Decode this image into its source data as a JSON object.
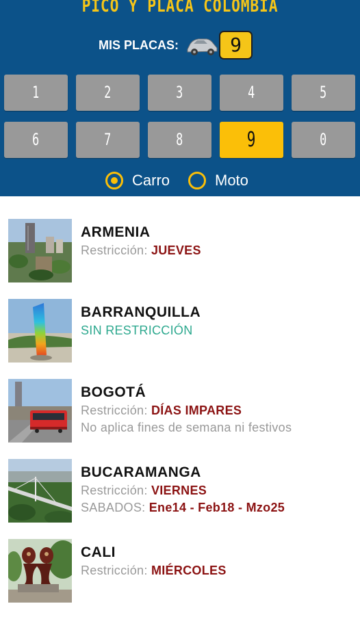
{
  "header": {
    "title": "PICO Y PLACA COLOMBIA",
    "my_plates_label": "MIS PLACAS:",
    "car_icon": "car-icon",
    "selected_plate": "9",
    "colors": {
      "background": "#0c5289",
      "accent": "#fbbf08",
      "digit_bg": "#999999"
    }
  },
  "digits": [
    "1",
    "2",
    "3",
    "4",
    "5",
    "6",
    "7",
    "8",
    "9",
    "0"
  ],
  "selected_digit": "9",
  "vehicle_type": {
    "options": [
      "Carro",
      "Moto"
    ],
    "selected": "Carro"
  },
  "cities": [
    {
      "name": "ARMENIA",
      "restriction_label": "Restricción: ",
      "restriction_value": "JUEVES"
    },
    {
      "name": "BARRANQUILLA",
      "status": "SIN RESTRICCIÓN"
    },
    {
      "name": "BOGOTÁ",
      "restriction_label": "Restricción: ",
      "restriction_value": "DÍAS IMPARES",
      "note": "No aplica fines de semana ni festivos"
    },
    {
      "name": "BUCARAMANGA",
      "restriction_label": "Restricción: ",
      "restriction_value": "VIERNES",
      "extra_label": "SABADOS: ",
      "extra_value": "Ene14 - Feb18 - Mzo25"
    },
    {
      "name": "CALI",
      "restriction_label": "Restricción: ",
      "restriction_value": "MIÉRCOLES"
    }
  ]
}
